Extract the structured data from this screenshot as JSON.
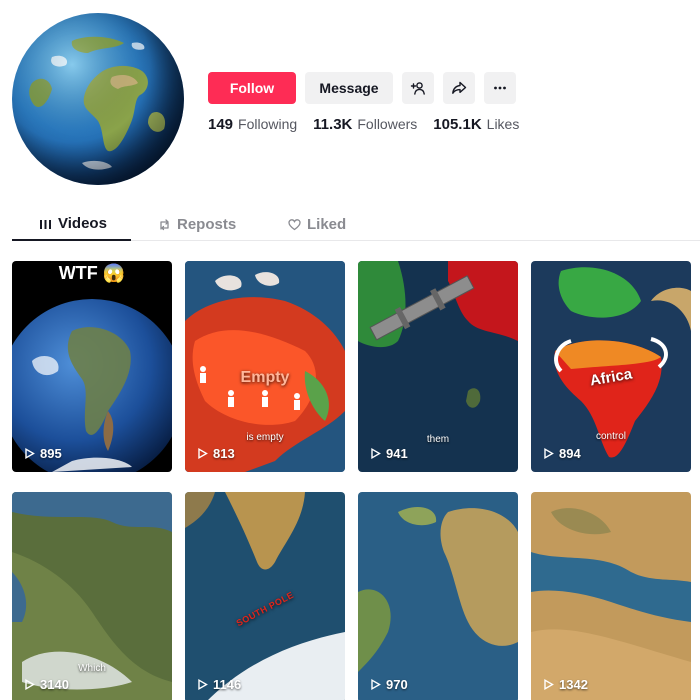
{
  "profile": {
    "avatar_icon": "earth-globe-avatar",
    "follow_label": "Follow",
    "message_label": "Message",
    "add_friend_icon": "add-friend-icon",
    "share_icon": "share-icon",
    "more_icon": "more-icon",
    "accent_color": "#fe2c55"
  },
  "stats": {
    "following_count": "149",
    "following_label": "Following",
    "followers_count": "11.3K",
    "followers_label": "Followers",
    "likes_count": "105.1K",
    "likes_label": "Likes"
  },
  "tabs": [
    {
      "label": "Videos",
      "active": true
    },
    {
      "label": "Reposts",
      "active": false
    },
    {
      "label": "Liked",
      "active": false
    }
  ],
  "videos": [
    {
      "views": "895",
      "overlay": "WTF 😱",
      "caption": ""
    },
    {
      "views": "813",
      "overlay": "Empty",
      "caption": "is empty"
    },
    {
      "views": "941",
      "overlay": "",
      "caption": "them"
    },
    {
      "views": "894",
      "overlay": "Africa",
      "caption": "control"
    },
    {
      "views": "3140",
      "overlay": "",
      "caption": "Which"
    },
    {
      "views": "1146",
      "overlay": "SOUTH POLE",
      "caption": ""
    },
    {
      "views": "970",
      "overlay": "",
      "caption": ""
    },
    {
      "views": "1342",
      "overlay": "",
      "caption": ""
    }
  ]
}
